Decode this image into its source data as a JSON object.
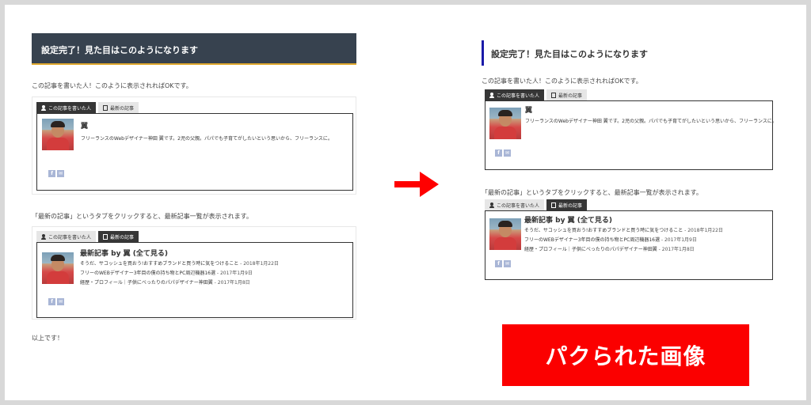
{
  "header_title": "設定完了！見た目はこのようになります",
  "intro_text": "この記事を書いた人！このように表示されればOKです。",
  "tab_author": "この記事を書いた人",
  "tab_recent": "最新の記事",
  "author_name": "翼",
  "author_desc": "フリーランスのWebデザイナー神田 翼です。2児の父親。パパでも子育てがしたいという思いから、フリーランスに。",
  "recent_text": "「最新の記事」というタブをクリックすると、最新記事一覧が表示されます。",
  "recent_title": "最新記事 by 翼 (全て見る)",
  "articles": [
    {
      "title": "そうだ、サコッシュを買おう!おすすめブランドと買う時に気をつけること",
      "date": " - 2018年1月22日"
    },
    {
      "title": "フリーのWEBデザイナー3年目の僕の持ち物とPC周辺機器16選",
      "date": " - 2017年1月9日"
    },
    {
      "title": "経歴・プロフィール｜子供にべったりのパパデザイナー神田翼",
      "date": " - 2017年1月8日"
    }
  ],
  "social": [
    "f",
    "✉"
  ],
  "closing_text": "以上です！",
  "banner_text": "パクられた画像",
  "colors": {
    "header_bg": "#37424f",
    "header_accent": "#e0a82e",
    "right_accent": "#1a1aa8",
    "arrow": "#ff0000",
    "banner": "#fb0000",
    "social": "#a9b6d6"
  }
}
